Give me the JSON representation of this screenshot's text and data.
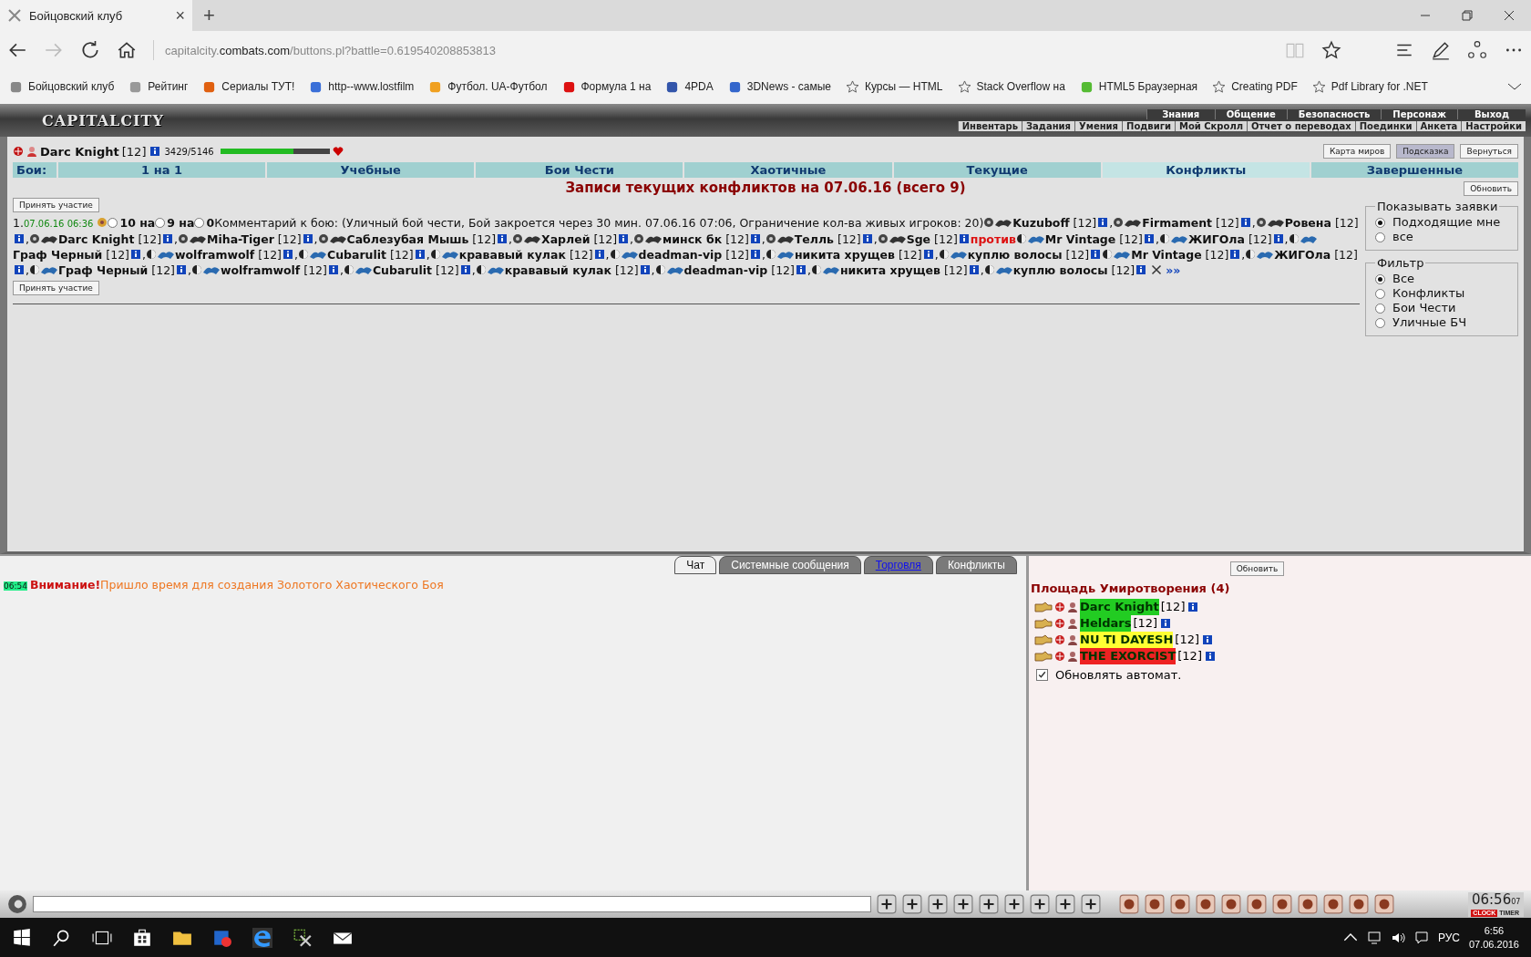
{
  "browser": {
    "tab": {
      "title": "Бойцовский клуб",
      "close": "×"
    },
    "new_tab": "+",
    "url": {
      "prefix": "capitalcity.",
      "domain": "combats.com",
      "path": "/buttons.pl?battle=0.619540208853813"
    },
    "bookmarks": [
      {
        "label": "Бойцовский клуб"
      },
      {
        "label": "Рейтинг"
      },
      {
        "label": "Сериалы ТУТ!"
      },
      {
        "label": "http--www.lostfilm"
      },
      {
        "label": "Футбол. UA-Футбол"
      },
      {
        "label": "Формула 1 на"
      },
      {
        "label": "4PDA"
      },
      {
        "label": "3DNews - самые"
      },
      {
        "label": "Курсы — HTML"
      },
      {
        "label": "Stack Overflow на"
      },
      {
        "label": "HTML5  Браузерная"
      },
      {
        "label": "Creating PDF"
      },
      {
        "label": "Pdf Library for .NET"
      }
    ]
  },
  "header": {
    "logo": "CAPITALCITY",
    "menu_top": [
      "Знания",
      "Общение",
      "Безопасность",
      "Персонаж",
      "Выход"
    ],
    "menu_bottom": [
      "Инвентарь",
      "Задания",
      "Умения",
      "Подвиги",
      "Мой Скролл",
      "Отчет о переводах",
      "Поединки",
      "Анкета",
      "Настройки"
    ]
  },
  "player": {
    "name": "Darc Knight",
    "level": "[12]",
    "hp": "3429/5146",
    "hp_bar": {
      "level": 0.666
    }
  },
  "top_buttons": [
    {
      "label": "Карта миров",
      "selected": false
    },
    {
      "label": "Подсказка",
      "selected": true
    },
    {
      "label": "Вернуться",
      "selected": false
    }
  ],
  "battle_tabs": {
    "label": "Бои:",
    "tabs": [
      {
        "label": "1 на 1",
        "selected": false
      },
      {
        "label": "Учебные",
        "selected": false
      },
      {
        "label": "Бои Чести",
        "selected": false
      },
      {
        "label": "Хаотичные",
        "selected": false
      },
      {
        "label": "Текущие",
        "selected": false
      },
      {
        "label": "Конфликты",
        "selected": true
      },
      {
        "label": "Завершенные",
        "selected": false
      }
    ]
  },
  "title": "Записи текущих конфликтов на 07.06.16 (всего 9)",
  "refresh": "Обновить",
  "join_top": "Принять участие",
  "join_bottom": "Принять участие",
  "battle": {
    "number": "1.",
    "time": "07.06.16 06:36",
    "options": [
      {
        "label": "10 на",
        "selected": false
      },
      {
        "label": "9 на",
        "selected": false
      },
      {
        "label": "0",
        "selected": false
      }
    ],
    "comment": "Комментарий к бою: (Уличный бой чести, Бой закроется через 30 мин. 07.06.16 07:06, Ограничение кол-ва живых игроков: 20)",
    "team1": [
      {
        "name": "Kuzuboff",
        "level": "[12]",
        "sep": ","
      },
      {
        "name": "Firmament",
        "level": "[12]",
        "sep": ","
      },
      {
        "name": "Ровена",
        "level": "[12]",
        "sep": ","
      },
      {
        "name": "Darc Knight",
        "level": "[12]",
        "sep": ","
      },
      {
        "name": "Miha-Tiger",
        "level": "[12]",
        "sep": ","
      },
      {
        "name": "Саблезубая Мышь",
        "level": "[12]",
        "sep": ","
      },
      {
        "name": "Харлей",
        "level": "[12]",
        "sep": ","
      },
      {
        "name": "минск бк",
        "level": "[12]",
        "sep": ","
      },
      {
        "name": "Телль",
        "level": "[12]",
        "sep": ","
      },
      {
        "name": "Sge",
        "level": "[12]"
      }
    ],
    "versus": "против",
    "team2": [
      {
        "name": "Mr Vintage",
        "level": "[12]",
        "sep": ","
      },
      {
        "name": "ЖИГОла",
        "level": "[12]",
        "sep": ","
      },
      {
        "name": "Граф Черный",
        "level": "[12]",
        "sep": ","
      },
      {
        "name": "wolframwolf",
        "level": "[12]",
        "sep": ","
      },
      {
        "name": "Cubarulit",
        "level": "[12]",
        "sep": ","
      },
      {
        "name": "крававый кулак",
        "level": "[12]",
        "sep": ","
      },
      {
        "name": "deadman-vip",
        "level": "[12]",
        "sep": ","
      },
      {
        "name": "никита хрущев",
        "level": "[12]",
        "sep": ","
      },
      {
        "name": "куплю волосы",
        "level": "[12]"
      },
      {
        "name": "Mr Vintage",
        "level": "[12]",
        "sep": ","
      },
      {
        "name": "ЖИГОла",
        "level": "[12]",
        "sep": ","
      },
      {
        "name": "Граф Черный",
        "level": "[12]",
        "sep": ","
      },
      {
        "name": "wolframwolf",
        "level": "[12]",
        "sep": ","
      },
      {
        "name": "Cubarulit",
        "level": "[12]",
        "sep": ","
      },
      {
        "name": "крававый кулак",
        "level": "[12]",
        "sep": ","
      },
      {
        "name": "deadman-vip",
        "level": "[12]",
        "sep": ","
      },
      {
        "name": "никита хрущев",
        "level": "[12]",
        "sep": ","
      },
      {
        "name": "куплю волосы",
        "level": "[12]"
      }
    ],
    "more": "»»"
  },
  "show_filter": {
    "legend": "Показывать заявки",
    "options": [
      {
        "label": "Подходящие мне",
        "selected": true
      },
      {
        "label": "все",
        "selected": false
      }
    ]
  },
  "type_filter": {
    "legend": "Фильтр",
    "options": [
      {
        "label": "Все",
        "selected": true
      },
      {
        "label": "Конфликты",
        "selected": false
      },
      {
        "label": "Бои Чести",
        "selected": false
      },
      {
        "label": "Уличные БЧ",
        "selected": false
      }
    ]
  },
  "chat": {
    "tabs": [
      {
        "label": "Чат",
        "selected": true,
        "highlighted": false
      },
      {
        "label": "Системные сообщения",
        "selected": false,
        "highlighted": false
      },
      {
        "label": "Торговля",
        "selected": false,
        "highlighted": true
      },
      {
        "label": "Конфликты",
        "selected": false,
        "highlighted": false
      }
    ],
    "messages": [
      {
        "time": "06:54",
        "alert": "Внимание!",
        "text": "Пришло время для создания Золотого Хаотического Боя"
      }
    ]
  },
  "room": {
    "refresh": "Обновить",
    "title": "Площадь Умиротворения (4)",
    "players": [
      {
        "name": "Darc Knight",
        "level": "[12]",
        "color": "#22cc22"
      },
      {
        "name": "Heldars",
        "level": "[12]",
        "color": "#22cc22"
      },
      {
        "name": "NU TI DAYESH",
        "level": "[12]",
        "color": "#ffff33"
      },
      {
        "name": "THE EXORCIST",
        "level": "[12]",
        "color": "#ee2222"
      }
    ],
    "auto_refresh": {
      "label": "Обновлять автомат.",
      "checked": true
    }
  },
  "clock": {
    "time": "06:56",
    "seconds": "07",
    "clock_label": "CLOCK",
    "timer_label": "TIMER"
  },
  "taskbar": {
    "lang": "РУС",
    "time": "6:56",
    "date": "07.06.2016"
  }
}
